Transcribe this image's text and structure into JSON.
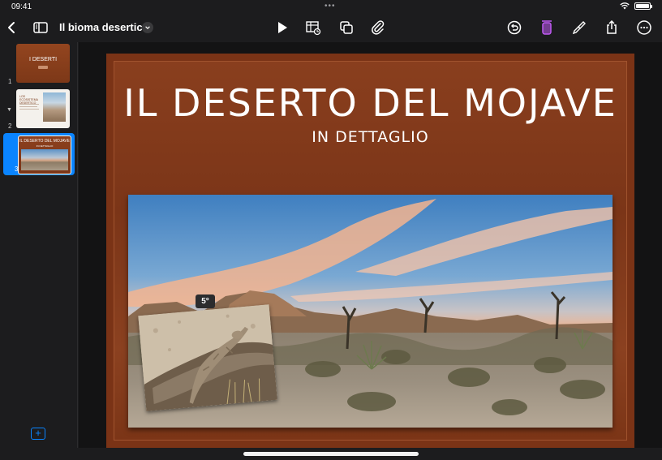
{
  "status": {
    "time": "09:41",
    "dots": "•••"
  },
  "toolbar": {
    "document_title": "Il bioma desertico",
    "accent_color": "#bf5af2",
    "icons": [
      "back-chevron-icon",
      "sidebar-icon",
      "play-icon",
      "table-chart-icon",
      "shapes-icon",
      "attachment-icon",
      "undo-icon",
      "format-icon",
      "brush-icon",
      "share-icon",
      "more-icon"
    ]
  },
  "sidebar": {
    "slides": [
      {
        "number": "1",
        "thumb_title": "I DESERTI"
      },
      {
        "number": "2",
        "thumb_title": "LOS ECOSISTEMA DESERTICO"
      },
      {
        "number": "3",
        "thumb_title": "IL DESERTO DEL MOJAVE",
        "thumb_subtitle": "IN DETTAGLIO",
        "selected": true
      }
    ],
    "add_label": "+"
  },
  "slide": {
    "title": "IL DESERTO DEL MOJAVE",
    "subtitle": "IN DETTAGLIO",
    "rotation_badge": "5°"
  }
}
